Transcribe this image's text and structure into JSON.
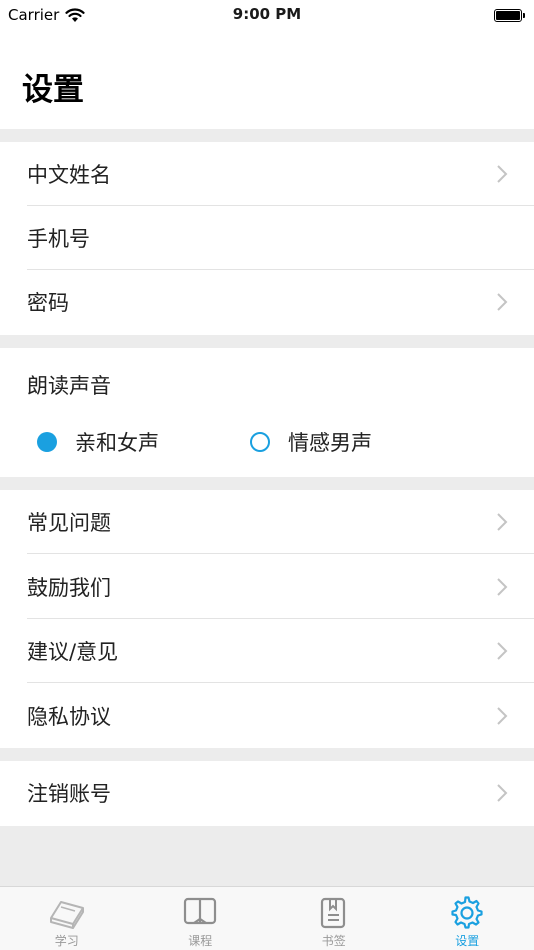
{
  "status_bar": {
    "carrier": "Carrier",
    "time": "9:00 PM"
  },
  "page": {
    "title": "设置"
  },
  "group1": [
    {
      "label": "中文姓名",
      "chevron": true
    },
    {
      "label": "手机号",
      "chevron": false
    },
    {
      "label": "密码",
      "chevron": true
    }
  ],
  "voice": {
    "title": "朗读声音",
    "options": [
      {
        "label": "亲和女声",
        "selected": true
      },
      {
        "label": "情感男声",
        "selected": false
      }
    ]
  },
  "group2": [
    {
      "label": "常见问题",
      "chevron": true
    },
    {
      "label": "鼓励我们",
      "chevron": true
    },
    {
      "label": "建议/意见",
      "chevron": true
    },
    {
      "label": "隐私协议",
      "chevron": true
    }
  ],
  "group3": [
    {
      "label": "注销账号",
      "chevron": true
    }
  ],
  "tabs": [
    {
      "label": "学习",
      "icon": "book-stack-icon",
      "active": false
    },
    {
      "label": "课程",
      "icon": "open-book-icon",
      "active": false
    },
    {
      "label": "书签",
      "icon": "bookmark-icon",
      "active": false
    },
    {
      "label": "设置",
      "icon": "gear-icon",
      "active": true
    }
  ],
  "colors": {
    "accent": "#1aa0e0",
    "separator": "#ececec",
    "inactive_tab": "#999999"
  }
}
